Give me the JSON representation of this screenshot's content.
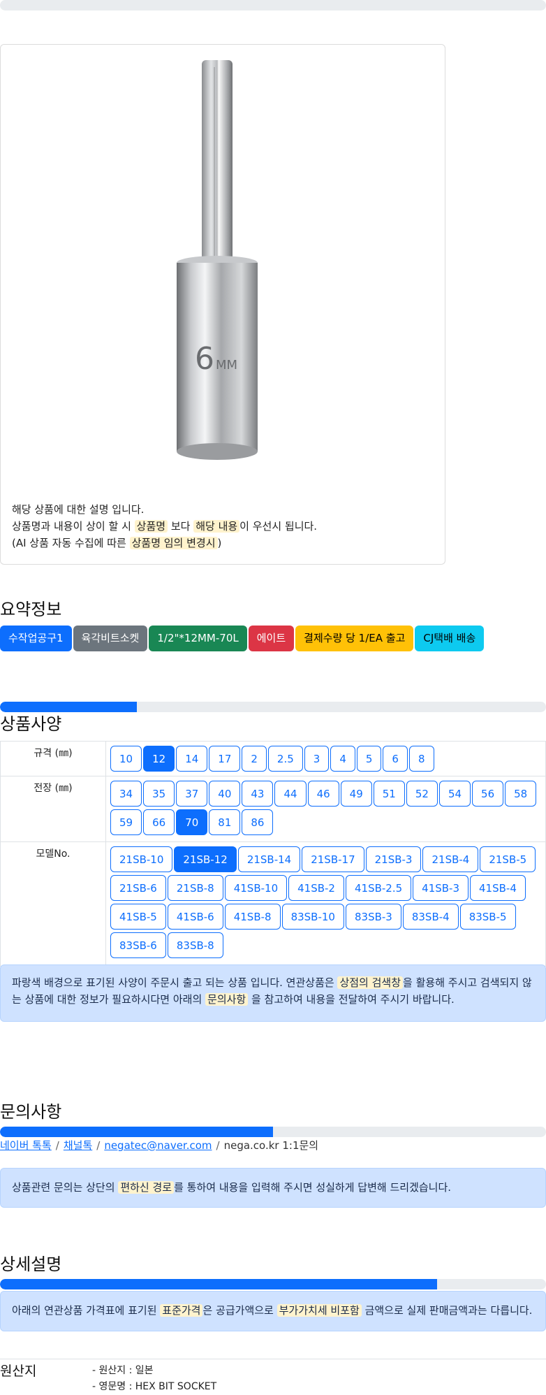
{
  "description": {
    "line1": "해당 상품에 대한 설명 입니다.",
    "line2_a": "상품명과 내용이 상이 할 시 ",
    "line2_hl1": "상품명",
    "line2_b": " 보다 ",
    "line2_hl2": "해당 내용",
    "line2_c": "이 우선시 됩니다.",
    "line3_a": "(AI 상품 자동 수집에 따른 ",
    "line3_hl": "상품명 임의 변경시",
    "line3_b": ")"
  },
  "summary": {
    "title": "요약정보",
    "badges": [
      {
        "label": "수작업공구1",
        "color": "#0d6efd",
        "text_color": "#ffffff"
      },
      {
        "label": "육각비트소켓",
        "color": "#6c757d",
        "text_color": "#ffffff"
      },
      {
        "label": "1/2\"*12MM-70L",
        "color": "#198754",
        "text_color": "#ffffff"
      },
      {
        "label": "에이트",
        "color": "#dc3545",
        "text_color": "#ffffff"
      },
      {
        "label": "결제수량 당 1/EA 출고",
        "color": "#ffc107",
        "text_color": "#000000"
      },
      {
        "label": "CJ택배 배송",
        "color": "#0dcaf0",
        "text_color": "#000000"
      }
    ]
  },
  "spec": {
    "title": "상품사양",
    "progress": 0.25,
    "rows": [
      {
        "label": "규격 (㎜)",
        "options": [
          "10",
          "12",
          "14",
          "17",
          "2",
          "2.5",
          "3",
          "4",
          "5",
          "6",
          "8"
        ],
        "selected": "12"
      },
      {
        "label": "전장 (㎜)",
        "options": [
          "34",
          "35",
          "37",
          "40",
          "43",
          "44",
          "46",
          "49",
          "51",
          "52",
          "54",
          "56",
          "58",
          "59",
          "66",
          "70",
          "81",
          "86"
        ],
        "selected": "70"
      },
      {
        "label": "모델No.",
        "options": [
          "21SB-10",
          "21SB-12",
          "21SB-14",
          "21SB-17",
          "21SB-3",
          "21SB-4",
          "21SB-5",
          "21SB-6",
          "21SB-8",
          "41SB-10",
          "41SB-2",
          "41SB-2.5",
          "41SB-3",
          "41SB-4",
          "41SB-5",
          "41SB-6",
          "41SB-8",
          "83SB-10",
          "83SB-3",
          "83SB-4",
          "83SB-5",
          "83SB-6",
          "83SB-8"
        ],
        "selected": "21SB-12"
      }
    ],
    "notice_a": "파랑색 배경으로 표기된 사양이 주문시 출고 되는 상품 입니다. 연관상품은 ",
    "notice_hl1": "상점의 검색창",
    "notice_b": "을 활용해 주시고 검색되지 않는 상품에 대한 정보가 필요하시다면 아래의 ",
    "notice_hl2": "문의사항",
    "notice_c": " 을 참고하여 내용을 전달하여 주시기 바랍니다."
  },
  "inquiry": {
    "title": "문의사항",
    "progress": 0.5,
    "links": [
      "네이버 톡톡",
      "채널톡",
      "negatec@naver.com"
    ],
    "plain": "nega.co.kr 1:1문의",
    "separator": "/",
    "notice_a": "상품관련 문의는 상단의 ",
    "notice_hl": "편하신 경로",
    "notice_b": "를 통하여 내용을 입력해 주시면 성실하게 답변해 드리겠습니다."
  },
  "detail": {
    "title": "상세설명",
    "progress": 0.8,
    "notice_a": "아래의 연관상품 가격표에 표기된 ",
    "notice_hl1": "표준가격",
    "notice_b": "은 공급가액으로 ",
    "notice_hl2": "부가가치세 비포함",
    "notice_c": " 금액으로 실제 판매금액과는 다릅니다."
  },
  "origin": {
    "label": "원산지",
    "items": [
      "- 원산지 : 일본",
      "- 영문명 : HEX BIT SOCKET"
    ]
  }
}
